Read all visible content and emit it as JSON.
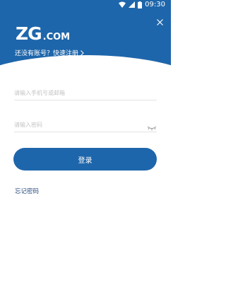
{
  "status_bar": {
    "time": "09:30",
    "icons": [
      "wifi-icon",
      "signal-icon",
      "battery-icon"
    ]
  },
  "header": {
    "logo_main": "ZG",
    "logo_suffix": ".COM",
    "register_prompt": "还没有账号？快速注册",
    "close_icon": "close-icon",
    "background_color": "#1e66ab"
  },
  "form": {
    "account_placeholder": "请输入手机号或邮箱",
    "account_value": "",
    "password_placeholder": "请输入密码",
    "password_value": "",
    "password_toggle_icon": "eye-hidden-icon"
  },
  "actions": {
    "login_label": "登录",
    "forgot_password_label": "忘记密码",
    "accent_color": "#1e66ab"
  }
}
